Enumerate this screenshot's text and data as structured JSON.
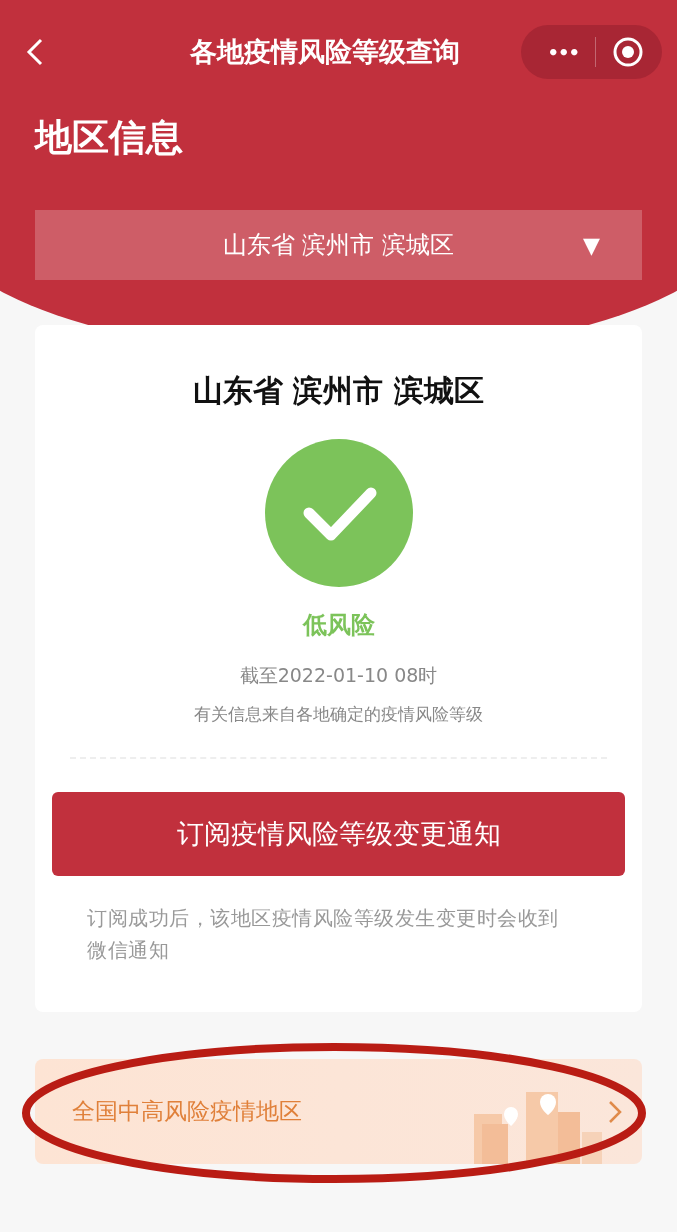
{
  "nav": {
    "title": "各地疫情风险等级查询",
    "more": "•••"
  },
  "section_title": "地区信息",
  "region_select": {
    "value": "山东省 滨州市 滨城区",
    "caret": "▼"
  },
  "result": {
    "area": "山东省 滨州市 滨城区",
    "risk": {
      "kind": "low",
      "label": "低风险"
    },
    "updated": "截至2022-01-10 08时",
    "source_note": "有关信息来自各地确定的疫情风险等级"
  },
  "subscribe_button": "订阅疫情风险等级变更通知",
  "subscribe_note": "订阅成功后，该地区疫情风险等级发生变更时会收到微信通知",
  "banner": {
    "label": "全国中高风险疫情地区",
    "highlighted": true
  }
}
